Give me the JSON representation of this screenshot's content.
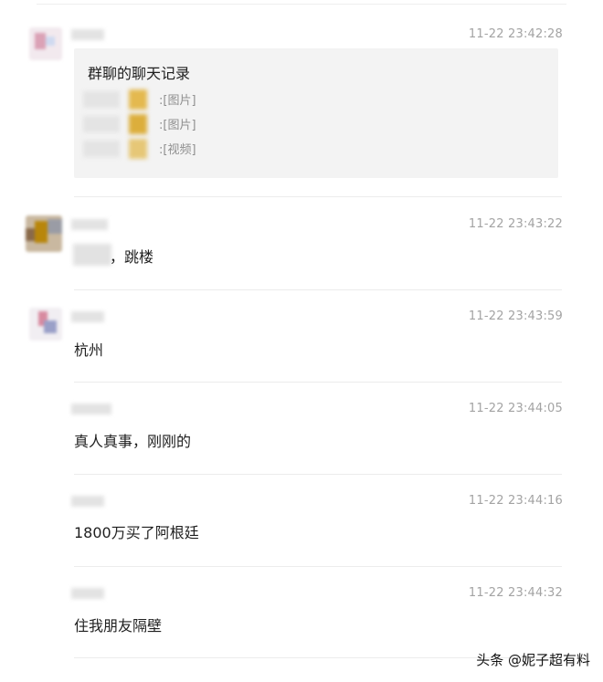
{
  "messages": [
    {
      "time": "11-22 23:42:28",
      "type": "chat_record",
      "record": {
        "title": "群聊的聊天记录",
        "items": [
          {
            "label": ":[图片]"
          },
          {
            "label": ":[图片]"
          },
          {
            "label": ":[视频]"
          }
        ]
      }
    },
    {
      "time": "11-22 23:43:22",
      "text": "，跳楼"
    },
    {
      "time": "11-22 23:43:59",
      "text": "杭州"
    },
    {
      "time": "11-22 23:44:05",
      "text": "真人真事，刚刚的"
    },
    {
      "time": "11-22 23:44:16",
      "text": "1800万买了阿根廷"
    },
    {
      "time": "11-22 23:44:32",
      "text": "住我朋友隔壁"
    }
  ],
  "watermark": "头条 @妮子超有料",
  "colors": {
    "card_bg": "#f3f3f3",
    "timestamp": "#a3a3a3",
    "divider": "#ececec"
  }
}
